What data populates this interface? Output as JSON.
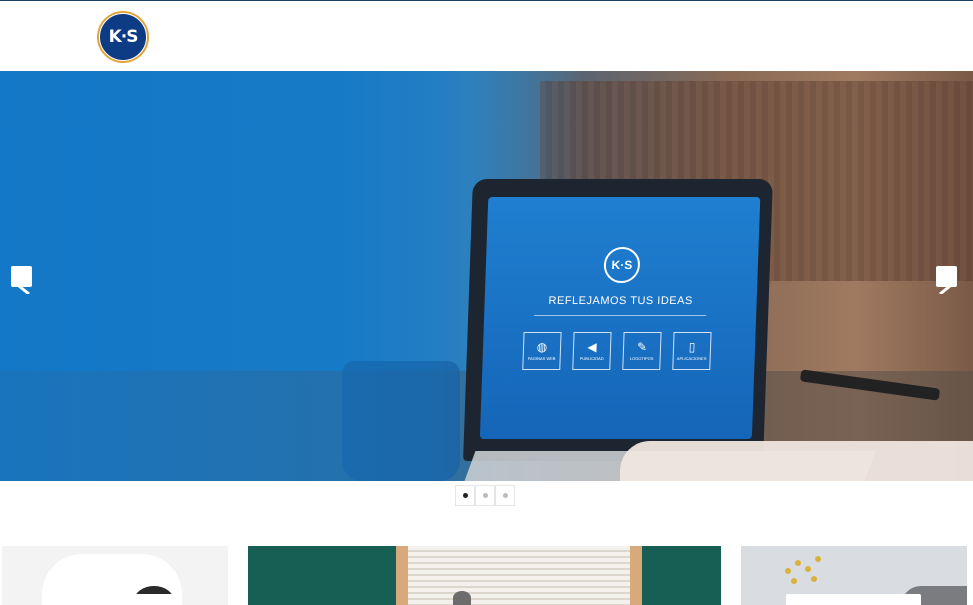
{
  "header": {
    "logo_text": "K·S",
    "brand_color": "#0d3c85",
    "accent_color": "#e0a43a"
  },
  "slider": {
    "screen_logo": "K·S",
    "tagline": "REFLEJAMOS TUS IDEAS",
    "tiles": [
      {
        "icon": "globe-icon",
        "label": "PAGINAS WEB"
      },
      {
        "icon": "megaphone-icon",
        "label": "PUBLICIDAD"
      },
      {
        "icon": "pencil-icon",
        "label": "LOGOTIPOS"
      },
      {
        "icon": "mobile-icon",
        "label": "APLICACIONES"
      }
    ],
    "active_slide": 1,
    "slide_count": 3
  }
}
